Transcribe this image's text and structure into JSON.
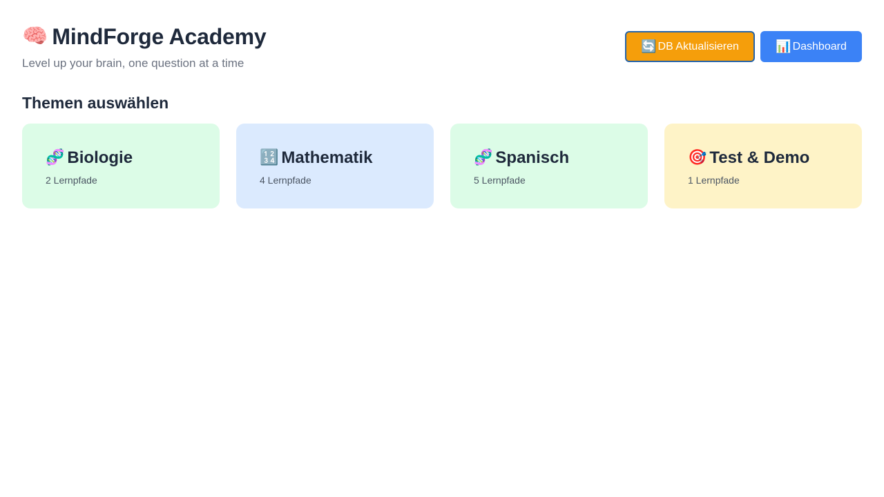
{
  "header": {
    "icon": "brain-icon",
    "icon_glyph": "🧠",
    "title": "MindForge Academy",
    "tagline": "Level up your brain, one question at a time"
  },
  "actions": {
    "db_update": {
      "icon": "refresh-icon",
      "icon_glyph": "🔄",
      "label": "DB Aktualisieren",
      "color": "#f59e0b"
    },
    "dashboard": {
      "icon": "bar-chart-icon",
      "icon_glyph": "📊",
      "label": "Dashboard",
      "color": "#3b82f6"
    }
  },
  "section": {
    "title": "Themen auswählen"
  },
  "topics": [
    {
      "icon": "dna-icon",
      "icon_glyph": "🧬",
      "title": "Biologie",
      "count": "2 Lernpfade",
      "color": "#dcfce7"
    },
    {
      "icon": "numbers-icon",
      "icon_glyph": "🔢",
      "title": "Mathematik",
      "count": "4 Lernpfade",
      "color": "#dbeafe"
    },
    {
      "icon": "dna-icon",
      "icon_glyph": "🧬",
      "title": "Spanisch",
      "count": "5 Lernpfade",
      "color": "#dcfce7"
    },
    {
      "icon": "target-icon",
      "icon_glyph": "🎯",
      "title": "Test & Demo",
      "count": "1 Lernpfade",
      "color": "#fef3c7"
    }
  ]
}
